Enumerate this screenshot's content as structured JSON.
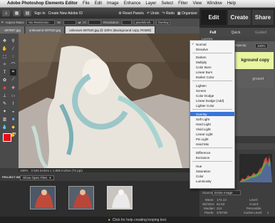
{
  "menubar": {
    "app_name": "Adobe Photoshop Elements Editor",
    "items": [
      "File",
      "Edit",
      "Image",
      "Enhance",
      "Layer",
      "Select",
      "Filter",
      "View",
      "Window",
      "Help"
    ]
  },
  "topbar": {
    "sign_in": "Sign In",
    "create_id": "Create New Adobe ID",
    "reset_panels": "Reset Panels",
    "undo": "Undo",
    "redo": "Redo",
    "organizer": "Organizer"
  },
  "tabs": {
    "edit": "Edit",
    "create": "Create",
    "share": "Share"
  },
  "options_bar": {
    "aspect_label": "Aspect Ratio:",
    "aspect_value": "No Restriction",
    "w_label": "W:",
    "h_label": "H:",
    "resolution_label": "Resolution:",
    "resolution_unit": "pixels/inch",
    "overlay_label": "Overlay"
  },
  "doc_tabs": [
    {
      "label": "-287507.jpg",
      "active": false
    },
    {
      "label": "unknown3-287520.jpg",
      "active": false
    },
    {
      "label": "unknown-287520.jpg @ 100% (Background copy, RGB/8)",
      "active": true
    }
  ],
  "subtabs": [
    "Full",
    "Quick",
    "Guided"
  ],
  "layers": {
    "header": "LAYERS",
    "opacity_label": "Opacity:",
    "opacity_value": "100%",
    "layer1_name": "kground copy",
    "layer2_name": "ground"
  },
  "blend_modes": [
    {
      "label": "Normal",
      "checked": true,
      "selected": false
    },
    {
      "label": "Dissolve",
      "checked": false,
      "selected": false
    },
    {
      "label": "Darken",
      "checked": false,
      "selected": false
    },
    {
      "label": "Multiply",
      "checked": false,
      "selected": false
    },
    {
      "label": "Color Burn",
      "checked": false,
      "selected": false
    },
    {
      "label": "Linear Burn",
      "checked": false,
      "selected": false
    },
    {
      "label": "Darker Color",
      "checked": false,
      "selected": false
    },
    {
      "label": "Lighten",
      "checked": false,
      "selected": false
    },
    {
      "label": "Screen",
      "checked": false,
      "selected": false
    },
    {
      "label": "Color Dodge",
      "checked": false,
      "selected": false
    },
    {
      "label": "Linear Dodge (Add)",
      "checked": false,
      "selected": false
    },
    {
      "label": "Lighter Color",
      "checked": false,
      "selected": false
    },
    {
      "label": "Overlay",
      "checked": false,
      "selected": true
    },
    {
      "label": "Soft Light",
      "checked": false,
      "selected": false
    },
    {
      "label": "Hard Light",
      "checked": false,
      "selected": false
    },
    {
      "label": "Vivid Light",
      "checked": false,
      "selected": false
    },
    {
      "label": "Linear Light",
      "checked": false,
      "selected": false
    },
    {
      "label": "Pin Light",
      "checked": false,
      "selected": false
    },
    {
      "label": "Hard Mix",
      "checked": false,
      "selected": false
    },
    {
      "label": "Difference",
      "checked": false,
      "selected": false
    },
    {
      "label": "Exclusion",
      "checked": false,
      "selected": false
    },
    {
      "label": "Hue",
      "checked": false,
      "selected": false
    },
    {
      "label": "Saturation",
      "checked": false,
      "selected": false
    },
    {
      "label": "Color",
      "checked": false,
      "selected": false
    },
    {
      "label": "Luminosity",
      "checked": false,
      "selected": false
    }
  ],
  "canvas": {
    "zoom": "100%",
    "doc_size": "2.525 inches x 1.806 inches (72 ppi)"
  },
  "project_bin": {
    "label": "PROJECT BIN",
    "show_open": "Show Open Files"
  },
  "histogram": {
    "source_label": "Source:",
    "source_value": "Entire Image",
    "stats": [
      {
        "label": "Mean:",
        "value": "174.13"
      },
      {
        "label": "Std Dev:",
        "value": "62.63"
      },
      {
        "label": "Median:",
        "value": "212"
      },
      {
        "label": "Pixels:",
        "value": "275730"
      }
    ],
    "right_labels": [
      "Level:",
      "Count:",
      "Percentile:",
      "Cache Level:"
    ],
    "cache_level_value": "1"
  },
  "bottom": {
    "hint": "Click for help creating looping text."
  },
  "colors": {
    "foreground": "#e0101a",
    "background": "#ffffff",
    "accent": "#3875d7",
    "layer_highlight": "#e8f4a0"
  }
}
